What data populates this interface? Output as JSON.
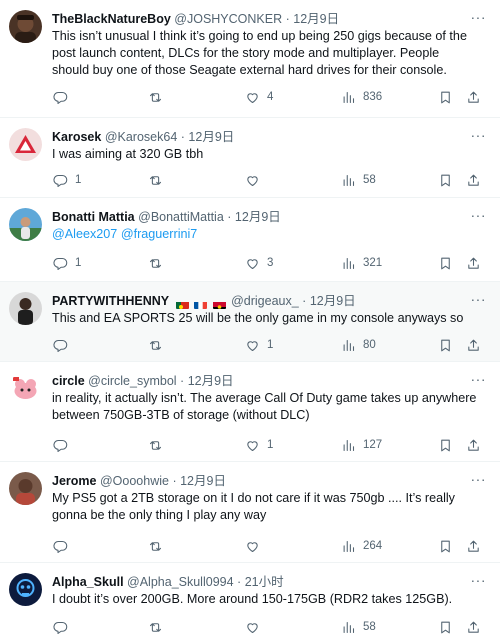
{
  "tweets": [
    {
      "name": "TheBlackNatureBoy",
      "handle": "@JOSHYCONKER",
      "sep": "·",
      "time": "12月9日",
      "text": "This isn’t unusual I think it’s going to end up being 250 gigs because of the post launch content, DLCs for the story mode and multiplayer. People should buy one of those Seagate external hard drives for their console.",
      "replies": "",
      "retweets": "",
      "likes": "4",
      "views": "836"
    },
    {
      "name": "Karosek",
      "handle": "@Karosek64",
      "sep": "·",
      "time": "12月9日",
      "text": "I was aiming at 320 GB tbh",
      "replies": "1",
      "retweets": "",
      "likes": "",
      "views": "58"
    },
    {
      "name": "Bonatti Mattia",
      "handle": "@BonattiMattia",
      "sep": "·",
      "time": "12月9日",
      "mentions": [
        "@Aleex207",
        "@fraguerrini7"
      ],
      "replies": "1",
      "retweets": "",
      "likes": "3",
      "views": "321"
    },
    {
      "name": "PARTYWITHHENNY",
      "handle": "@drigeaux_",
      "sep": "·",
      "time": "12月9日",
      "text": "This and EA SPORTS 25 will be the only game in my console anyways so",
      "replies": "",
      "retweets": "",
      "likes": "1",
      "views": "80"
    },
    {
      "name": "circle",
      "handle": "@circle_symbol",
      "sep": "·",
      "time": "12月9日",
      "text": "in reality, it actually isn’t. The average Call Of Duty game takes up anywhere between 750GB-3TB of storage (without DLC)",
      "replies": "",
      "retweets": "",
      "likes": "1",
      "views": "127"
    },
    {
      "name": "Jerome",
      "handle": "@Oooohwie",
      "sep": "·",
      "time": "12月9日",
      "text": "My PS5 got a 2TB storage on it I do not care if it was 750gb .... It’s really gonna be the only thing I play any way",
      "replies": "",
      "retweets": "",
      "likes": "",
      "views": "264"
    },
    {
      "name": "Alpha_Skull",
      "handle": "@Alpha_Skull0994",
      "sep": "·",
      "time": "21小时",
      "text": "I doubt it’s over 200GB. More around 150-175GB (RDR2 takes 125GB).",
      "replies": "",
      "retweets": "",
      "likes": "",
      "views": "58"
    }
  ],
  "icons": {
    "more": "more-icon",
    "reply": "reply-icon",
    "retweet": "retweet-icon",
    "like": "heart-icon",
    "views": "views-icon",
    "bookmark": "bookmark-icon",
    "share": "share-icon"
  },
  "colors": {
    "text": "#0f1419",
    "muted": "#536471",
    "link": "#1d9bf0",
    "divider": "#eff3f4",
    "highlight": "#f7f9f9"
  }
}
